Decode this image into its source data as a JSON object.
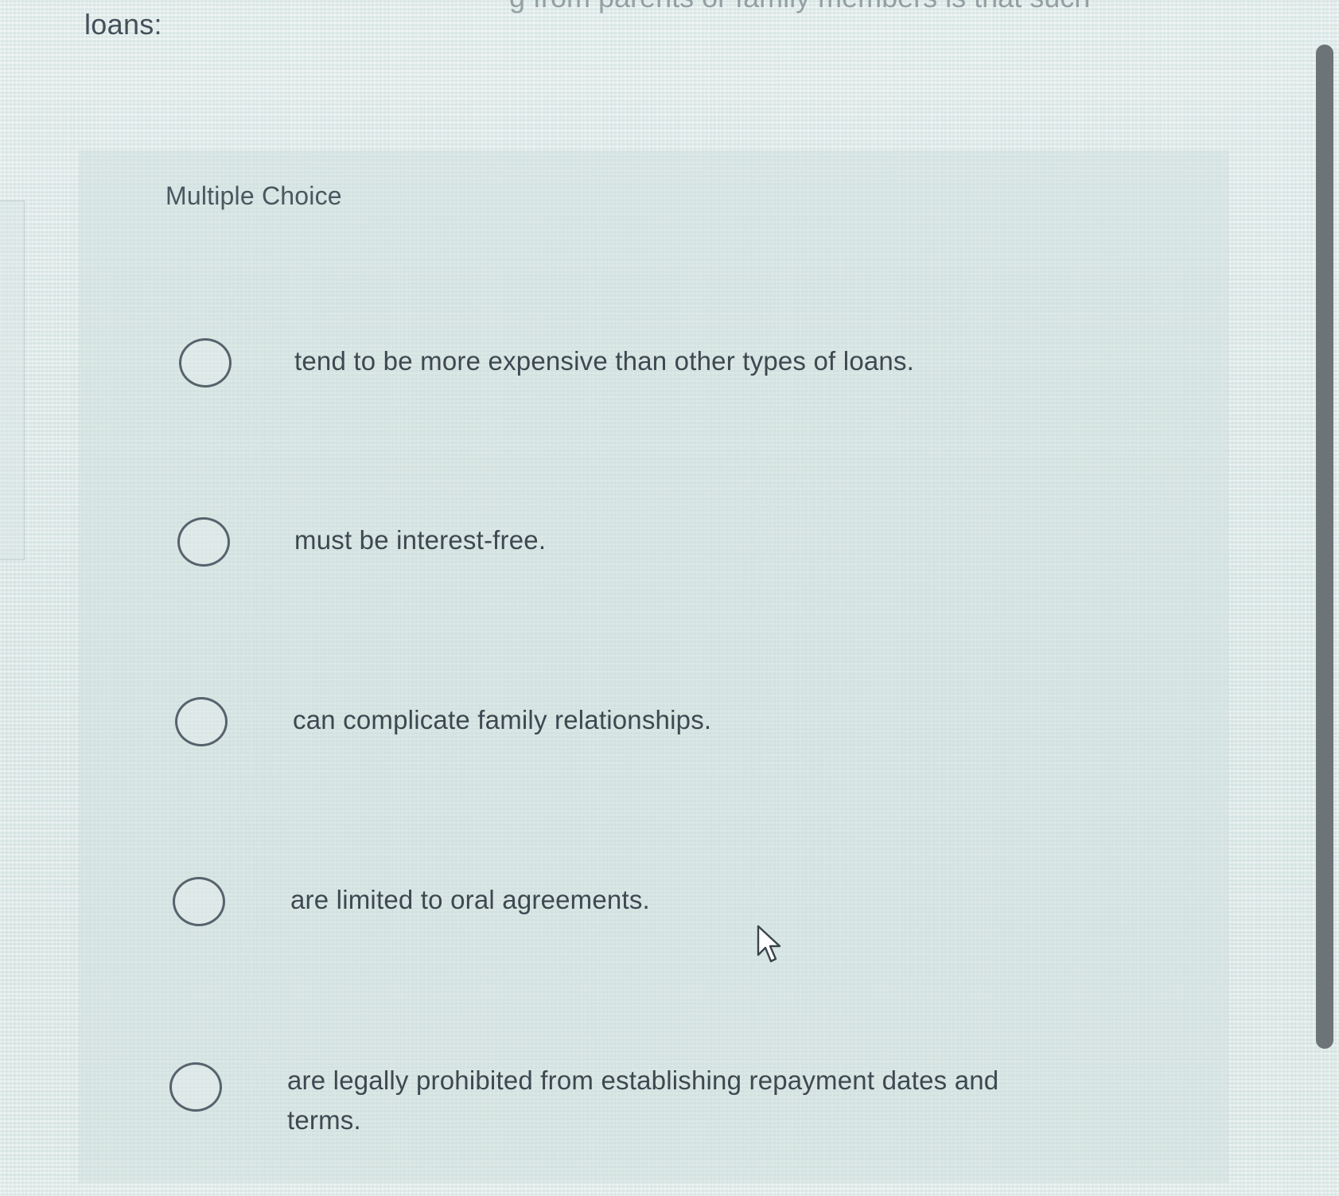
{
  "question": {
    "stem_tail": "loans:",
    "stem_cutoff_line": "g from parents or family members is that such"
  },
  "card": {
    "heading": "Multiple Choice",
    "options": [
      {
        "label": "tend to be more expensive than other types of loans.",
        "selected": false
      },
      {
        "label": "must be interest-free.",
        "selected": false
      },
      {
        "label": "can complicate family relationships.",
        "selected": false
      },
      {
        "label": "are limited to oral agreements.",
        "selected": false
      },
      {
        "label": "are legally prohibited from establishing repayment dates and terms.",
        "selected": false
      }
    ]
  },
  "colors": {
    "background": "#dfe9e8",
    "text": "#3d4850",
    "radio_border": "#56626c",
    "scrollbar_thumb": "#6c7478"
  },
  "icons": {
    "radio": "radio-circle-icon",
    "cursor": "mouse-pointer-icon"
  }
}
